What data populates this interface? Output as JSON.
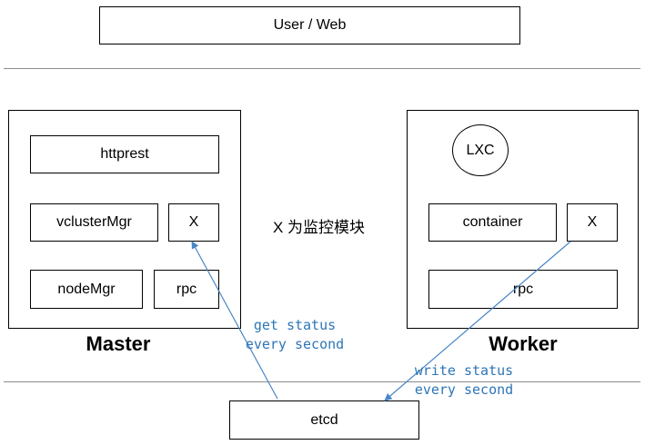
{
  "top": {
    "user_web": "User / Web"
  },
  "master": {
    "title": "Master",
    "httprest": "httprest",
    "vclustermgr": "vclusterMgr",
    "monitor": "X",
    "nodemgr": "nodeMgr",
    "rpc": "rpc"
  },
  "worker": {
    "title": "Worker",
    "lxc": "LXC",
    "container": "container",
    "monitor": "X",
    "rpc": "rpc"
  },
  "legend": "X 为监控模块",
  "etcd": "etcd",
  "notes": {
    "get_line1": "get status",
    "get_line2": "every second",
    "write_line1": "write status",
    "write_line2": "every second"
  },
  "colors": {
    "arrow": "#4a86c5",
    "note_text": "#2e75b6",
    "separator": "#8c8c8c"
  }
}
